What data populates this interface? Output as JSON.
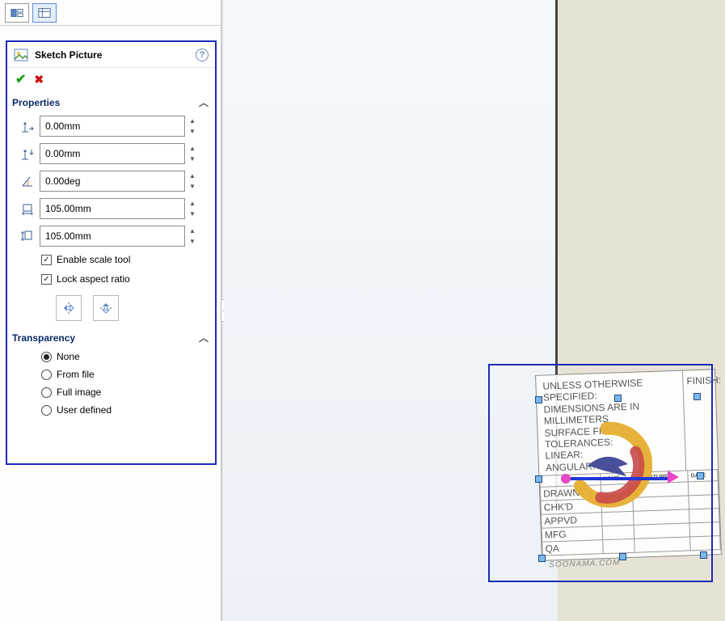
{
  "panel": {
    "title": "Sketch Picture",
    "sections": {
      "properties": {
        "heading": "Properties",
        "x": "0.00mm",
        "y": "0.00mm",
        "angle": "0.00deg",
        "width": "105.00mm",
        "height": "105.00mm",
        "enable_scale_tool": "Enable scale tool",
        "lock_aspect_ratio": "Lock aspect ratio"
      },
      "transparency": {
        "heading": "Transparency",
        "options": {
          "none": "None",
          "from_file": "From file",
          "full_image": "Full image",
          "user_defined": "User defined"
        }
      }
    }
  },
  "titleblock": {
    "notes": {
      "line1": "UNLESS OTHERWISE SPECIFIED:",
      "line2": "DIMENSIONS ARE IN MILLIMETERS",
      "line3": "SURFACE FINISH:",
      "line4": "TOLERANCES:",
      "line5": "  LINEAR:",
      "line6": "  ANGULAR:",
      "finish": "FINISH:"
    },
    "table": {
      "name": "NAME",
      "signature": "SIGNATURE",
      "date": "DATE",
      "rows": {
        "drawn": "DRAWN",
        "chkd": "CHK'D",
        "appvd": "APPVD",
        "mfg": "MFG",
        "qa": "QA"
      }
    },
    "brand": "SOONAMA.COM"
  }
}
